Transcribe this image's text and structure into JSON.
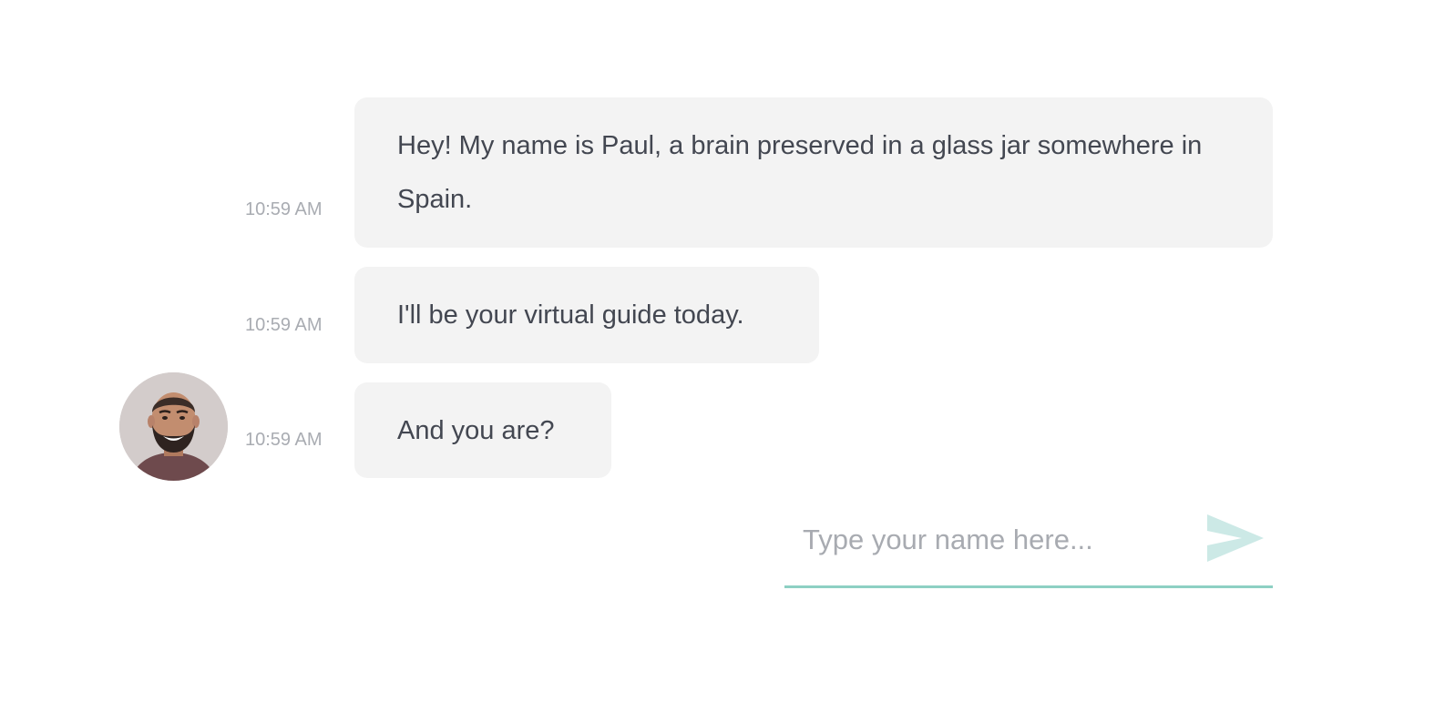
{
  "chat": {
    "messages": [
      {
        "text": "Hey! My name is Paul, a brain preserved in a glass jar somewhere in Spain.",
        "time": "10:59 AM"
      },
      {
        "text": "I'll be your virtual guide today.",
        "time": "10:59 AM"
      },
      {
        "text": "And you are?",
        "time": "10:59 AM"
      }
    ],
    "avatar_icon": "person-photo-avatar"
  },
  "composer": {
    "placeholder": "Type your name here...",
    "value": "",
    "send_icon": "send-arrow-icon",
    "accent_color": "#8dd0c3"
  },
  "colors": {
    "bubble": "#f3f3f3",
    "text": "#434751",
    "timestamp": "#a9acb2"
  }
}
